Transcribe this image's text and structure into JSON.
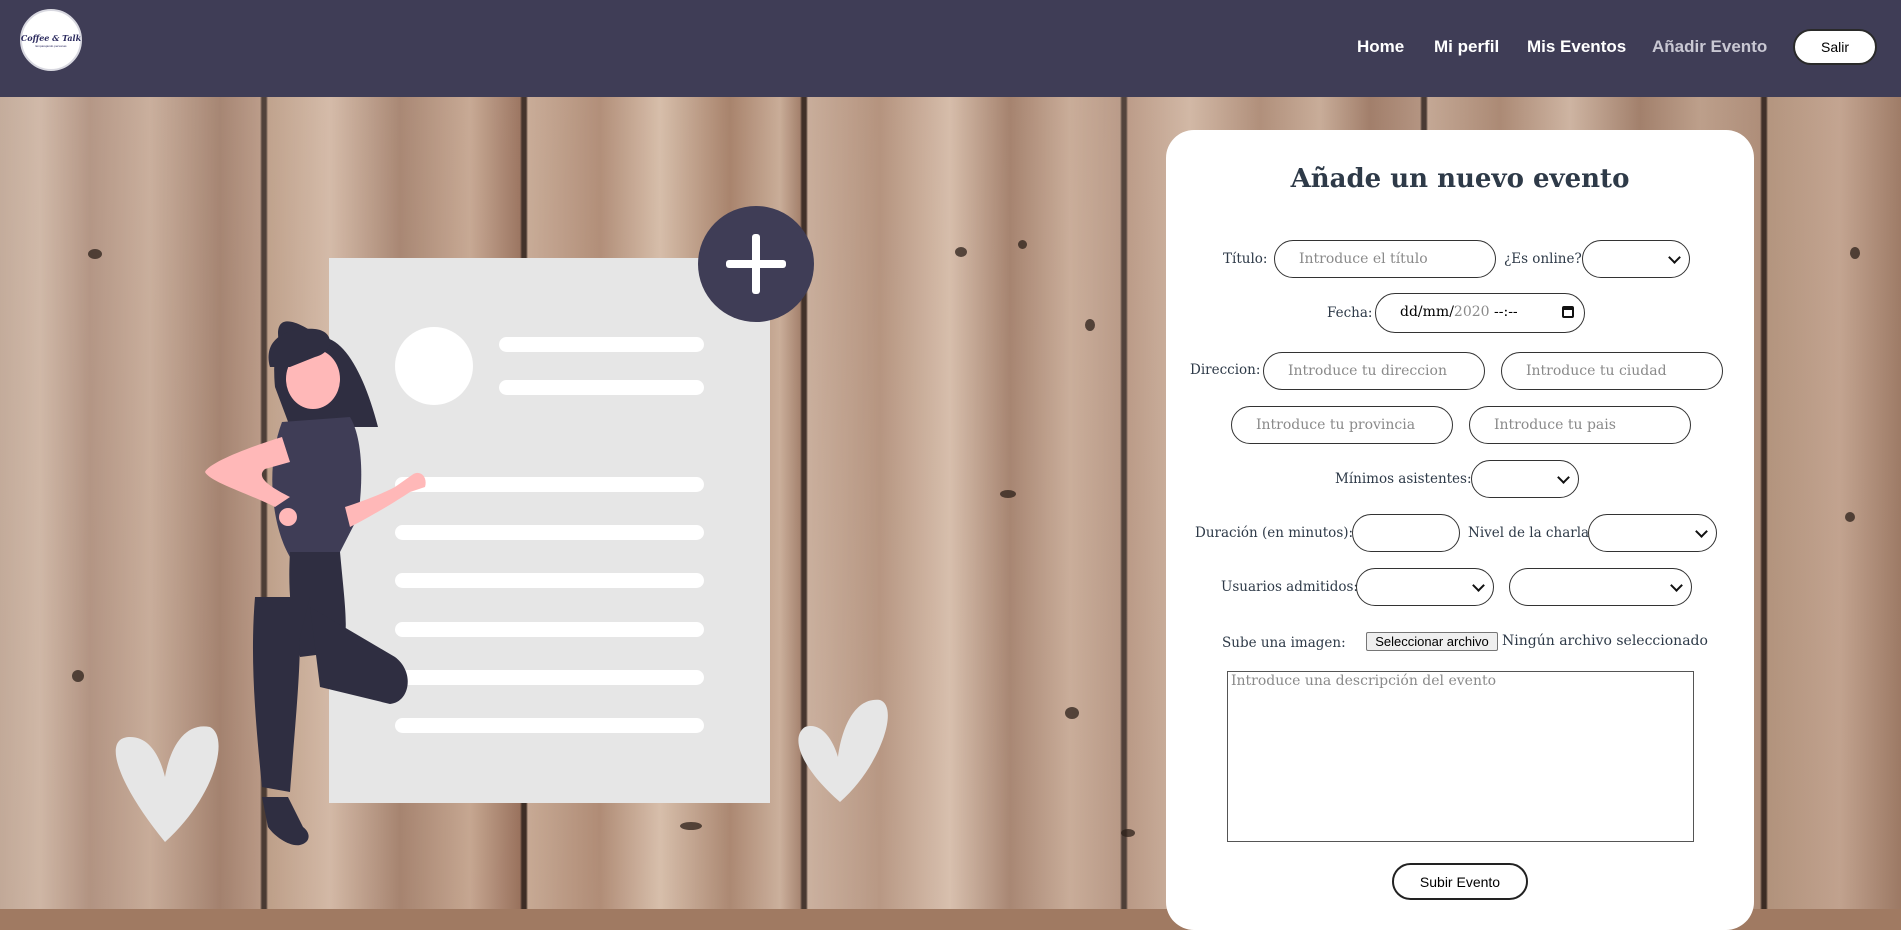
{
  "header": {
    "logo_text": "Coffee & Talk",
    "logo_sub": "Emparejando personas",
    "nav": [
      "Home",
      "Mi perfil",
      "Mis Eventos",
      "Añadir Evento"
    ],
    "active_nav": "Añadir Evento",
    "logout_label": "Salir"
  },
  "form": {
    "title": "Añade un nuevo evento",
    "titulo_label": "Título:",
    "titulo_placeholder": "Introduce el título",
    "online_label": "¿Es online?",
    "online_value": "",
    "fecha_label": "Fecha:",
    "fecha_value": "dd/mm/",
    "fecha_placeholder_year": "2020",
    "fecha_time": " --:--",
    "direccion_label": "Direccion:",
    "direccion_placeholder": "Introduce tu direccion",
    "ciudad_placeholder": "Introduce tu ciudad",
    "provincia_placeholder": "Introduce tu provincia",
    "pais_placeholder": "Introduce tu pais",
    "minimos_label": "Mínimos asistentes:",
    "minimos_value": "",
    "duracion_label": "Duración (en minutos):",
    "duracion_value": "",
    "nivel_label": "Nivel de la charla:",
    "nivel_value": "",
    "usuarios_label": "Usuarios admitidos:",
    "usuarios_min_value": "",
    "usuarios_max_value": "",
    "imagen_label": "Sube una imagen:",
    "file_button": "Seleccionar archivo",
    "file_status": "Ningún archivo seleccionado",
    "descripcion_placeholder": "Introduce una descripción del evento",
    "submit_label": "Subir Evento"
  },
  "colors": {
    "header_bg": "#3f3d56",
    "illustration_accent": "#3f3d56",
    "skin": "#ffb8b8",
    "paper": "#e6e6e6"
  },
  "icons": [
    "plus-icon",
    "chevron-down-icon",
    "calendar-icon"
  ]
}
